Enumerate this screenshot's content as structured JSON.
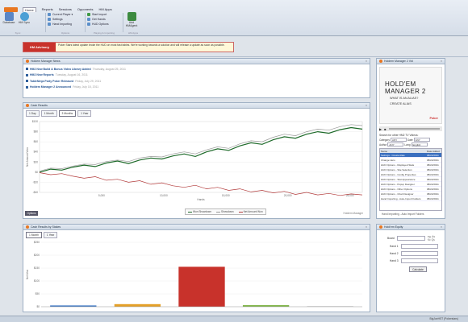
{
  "ribbon": {
    "tabs": [
      "Home",
      "Reports",
      "Sessions",
      "Opponents",
      "HM Apps"
    ],
    "big_buttons": [
      {
        "label": "Database",
        "color": "#5a86c6"
      },
      {
        "label": "HM Sync",
        "color": "#4b9fd5"
      }
    ],
    "sync_group": "Sync",
    "small_group1": [
      "Current Player ▾",
      "Settings",
      "Hand Importing"
    ],
    "small_group1_label": "Options",
    "small_group2": [
      "Start Import",
      "Get Hands",
      "HUD Options"
    ],
    "small_group2_label": "Playing & Importing",
    "hud_button": "Add HMAgent",
    "hud_color": "#3c8a3f",
    "apps_label": "HM Apps"
  },
  "advisory": {
    "tag": "HM Advisory",
    "text": "Poker Stars latest update broke the HUD on most fast tables. We're working towards a solution and will release a update as soon as possible."
  },
  "news": {
    "title": "Holdem Manager News",
    "items": [
      {
        "title": "HM2 New Build & Bonus Video Library Added",
        "date": "Thursday, August 25, 2011"
      },
      {
        "title": "HM2 New Reports",
        "date": "Tuesday, August 16, 2011"
      },
      {
        "title": "TableNinja Party Poker Released",
        "date": "Friday, July 29, 2011"
      },
      {
        "title": "Holdem Manager 2 Announced",
        "date": "Friday, July 15, 2011"
      }
    ]
  },
  "cash": {
    "title": "Cash Results",
    "tabs": [
      "1 Day",
      "1 Month",
      "3 Months",
      "1 Year"
    ],
    "selected_tab": 2,
    "legend": [
      "Won Showdown",
      "Showdown",
      "Net Amount Won"
    ],
    "xlabel": "Hands",
    "ylabel": "Net Amount Won",
    "options": "Options",
    "brand": "Holdem Manager"
  },
  "chart_data": [
    {
      "type": "line",
      "title": "",
      "xlabel": "Hands",
      "ylabel": "Net Amount Won",
      "x_ticks": [
        "5,000",
        "10,000",
        "15,000",
        "20,000",
        "25,000"
      ],
      "y_ticks": [
        "$100",
        "$80",
        "$60",
        "$40",
        "$20",
        "$0",
        "-$20",
        "-$40"
      ],
      "series": [
        {
          "name": "Won Showdown",
          "color": "#1e6a2a",
          "values": [
            0,
            6,
            4,
            10,
            14,
            11,
            18,
            22,
            17,
            24,
            28,
            26,
            32,
            36,
            31,
            40,
            46,
            43,
            52,
            58,
            55,
            64,
            70,
            67,
            75,
            80,
            77,
            84,
            88,
            85
          ]
        },
        {
          "name": "Showdown",
          "color": "#999999",
          "values": [
            2,
            8,
            7,
            12,
            16,
            15,
            21,
            24,
            21,
            28,
            31,
            30,
            36,
            40,
            36,
            44,
            50,
            47,
            56,
            62,
            60,
            69,
            75,
            72,
            80,
            85,
            83,
            90,
            94,
            92
          ]
        },
        {
          "name": "Net Amount Won",
          "color": "#b23a3a",
          "values": [
            -1,
            -5,
            -3,
            -8,
            -12,
            -9,
            -16,
            -14,
            -20,
            -17,
            -24,
            -21,
            -27,
            -30,
            -26,
            -33,
            -30,
            -36,
            -33,
            -39,
            -36,
            -41,
            -38,
            -44,
            -40,
            -45,
            -42,
            -46,
            -43,
            -45
          ]
        }
      ]
    },
    {
      "type": "bar",
      "title": "",
      "xlabel": "",
      "ylabel": "Net Won",
      "y_ticks": [
        "$250",
        "$200",
        "$150",
        "$100",
        "$50",
        "$0"
      ],
      "categories": [
        "",
        "",
        "",
        "",
        ""
      ],
      "values": [
        5,
        10,
        155,
        6,
        2
      ],
      "colors": [
        "#3e78c6",
        "#e4a028",
        "#c8322b",
        "#7cb342",
        "#bbbbbb"
      ]
    }
  ],
  "stakes": {
    "title": "Cash Results by Stakes",
    "tabs": [
      "1 Month",
      "1 Year"
    ]
  },
  "videos": {
    "title": "Holdem Manager 2 Vid",
    "hero_title": "HOLD'EM MANAGER 2",
    "lines": [
      "WHAT IS AN ALIAS?",
      "CREATE ALIAS"
    ],
    "logo": "Poker",
    "search_label": "Search for other HM2 TV Videos:",
    "filters": [
      {
        "label": "Category",
        "value": "ANY",
        "label2": "Date",
        "value2": "ANY"
      },
      {
        "label": "Author",
        "value": "ANY",
        "label2": "Lang",
        "value2": "English"
      }
    ],
    "columns": [
      "Name",
      "Date Added"
    ],
    "rows": [
      {
        "name": "Settings - Create Alias",
        "date": "08/22/2011",
        "hl": true
      },
      {
        "name": "Change Hero",
        "date": "08/22/2011",
        "hl": false
      },
      {
        "name": "HUD Options - Displayed Stats",
        "date": "08/22/2011",
        "hl": false
      },
      {
        "name": "HUD Options - Site Selection",
        "date": "08/22/2011",
        "hl": false
      },
      {
        "name": "HUD Options - Config Properties",
        "date": "08/22/2011",
        "hl": false
      },
      {
        "name": "HUD Options - Stat Appearance",
        "date": "08/22/2011",
        "hl": false
      },
      {
        "name": "HUD Options - Popup Designer",
        "date": "08/22/2011",
        "hl": false
      },
      {
        "name": "HUD Options - Other Options",
        "date": "08/22/2011",
        "hl": false
      },
      {
        "name": "HUD Options - Chart Designer",
        "date": "08/22/2011",
        "hl": false
      },
      {
        "name": "Hand Importing - Auto-Import Folders",
        "date": "08/22/2011",
        "hl": false
      }
    ],
    "status": "Hand Importing - Auto Import Folders"
  },
  "equity": {
    "title": "Hold'em Equity",
    "fields": [
      {
        "label": "Board",
        "unit": "eg. As Kc Qs"
      },
      {
        "label": "Hand 1",
        "unit": ""
      },
      {
        "label": "Hand 2",
        "unit": ""
      },
      {
        "label": "Hand 3",
        "unit": ""
      }
    ],
    "button": "Calculate"
  },
  "statusbar": {
    "user": "BigJoeHST (Pokerstars)"
  }
}
